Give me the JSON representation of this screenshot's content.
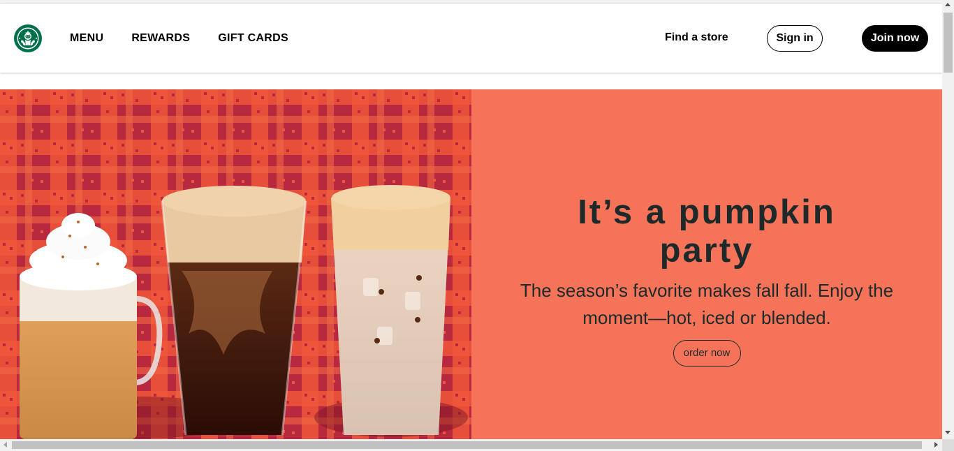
{
  "colors": {
    "brand_green": "#00704a",
    "hero_panel": "#f57359",
    "plaid_red": "#b8293d",
    "plaid_orange": "#f0563a",
    "text_dark": "#1e2a2a"
  },
  "header": {
    "logo_icon": "starbucks-siren-logo",
    "nav": [
      {
        "label": "MENU"
      },
      {
        "label": "REWARDS"
      },
      {
        "label": "GIFT CARDS"
      }
    ],
    "find_store": "Find a store",
    "sign_in": "Sign in",
    "join_now": "Join now"
  },
  "hero": {
    "title": "It’s a pumpkin party",
    "body": "The season’s favorite makes fall fall. Enjoy the moment—hot, iced or blended.",
    "cta": "order now",
    "image_subject": "pumpkin-spice-drinks-image"
  }
}
